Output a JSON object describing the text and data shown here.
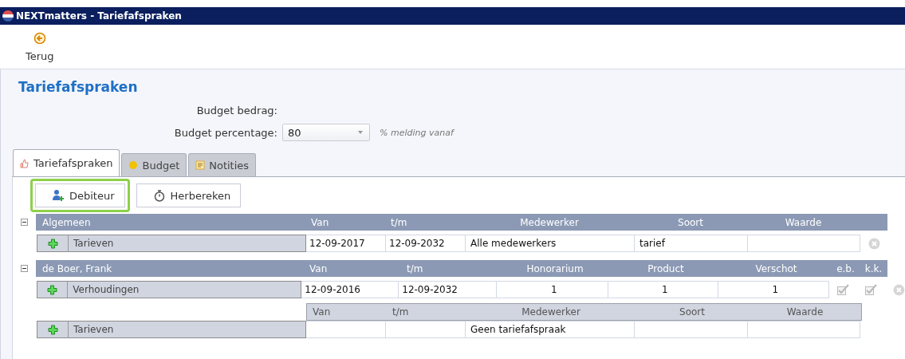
{
  "window": {
    "title": "NEXTmatters - Tariefafspraken"
  },
  "toolbar": {
    "back_label": "Terug"
  },
  "heading": "Tariefafspraken",
  "form": {
    "budget_amount_label": "Budget bedrag:",
    "budget_percentage_label": "Budget percentage:",
    "budget_percentage_value": "80",
    "budget_percentage_hint": "% melding vanaf"
  },
  "tabs": [
    {
      "label": "Tariefafspraken",
      "selected": true,
      "kind": "agreement"
    },
    {
      "label": "Budget",
      "selected": false,
      "kind": "budget"
    },
    {
      "label": "Notities",
      "selected": false,
      "kind": "notes"
    }
  ],
  "actions": [
    {
      "label": "Debiteur",
      "kind": "add-person",
      "focused": true
    },
    {
      "label": "Herbereken",
      "kind": "stopwatch",
      "focused": false
    }
  ],
  "groups": [
    {
      "name": "Algemeen",
      "expanded": true,
      "columns": [
        {
          "label": "Van",
          "kind": "date"
        },
        {
          "label": "t/m",
          "kind": "date"
        },
        {
          "label": "Medewerker",
          "kind": "text"
        },
        {
          "label": "Soort",
          "kind": "text"
        },
        {
          "label": "Waarde",
          "kind": "text"
        }
      ],
      "rows": [
        {
          "label": "Tarieven",
          "cells": [
            "12-09-2017",
            "12-09-2032",
            "Alle medewerkers",
            "tarief",
            null
          ],
          "removable": true
        }
      ]
    },
    {
      "name": "de Boer, Frank",
      "expanded": true,
      "columns": [
        {
          "label": "Van",
          "kind": "date"
        },
        {
          "label": "t/m",
          "kind": "date"
        },
        {
          "label": "Honorarium",
          "kind": "number"
        },
        {
          "label": "Product",
          "kind": "number"
        },
        {
          "label": "Verschot",
          "kind": "number"
        },
        {
          "label": "e.b.",
          "kind": "check"
        },
        {
          "label": "k.k.",
          "kind": "check"
        }
      ],
      "rows": [
        {
          "label": "Verhoudingen",
          "cells": [
            "12-09-2016",
            "12-09-2032",
            "1",
            "1",
            "1",
            {
              "checked": true
            },
            {
              "checked": true
            }
          ],
          "removable": true
        }
      ],
      "subsections": [
        {
          "columns": [
            {
              "label": "Van",
              "kind": "date"
            },
            {
              "label": "t/m",
              "kind": "date"
            },
            {
              "label": "Medewerker",
              "kind": "text"
            },
            {
              "label": "Soort",
              "kind": "text"
            },
            {
              "label": "Waarde",
              "kind": "text"
            }
          ],
          "rows": [
            {
              "label": "Tarieven",
              "cells": [
                null,
                null,
                "Geen tariefafspraak",
                null,
                null
              ],
              "removable": false
            }
          ]
        }
      ]
    }
  ]
}
